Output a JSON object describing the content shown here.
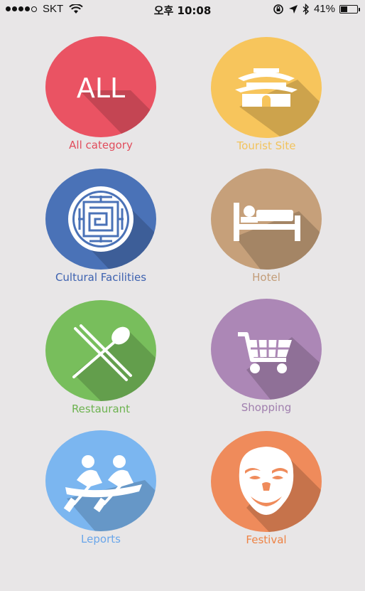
{
  "status_bar": {
    "carrier": "SKT",
    "time": "오후 10:08",
    "battery_percent": "41%",
    "battery_level": 0.41
  },
  "categories": [
    {
      "label": "All category",
      "icon": "all-icon",
      "color": "#ea5363",
      "label_color": "#e14d5c",
      "icon_text": "ALL"
    },
    {
      "label": "Tourist Site",
      "icon": "palace-gate-icon",
      "color": "#f7c55c",
      "label_color": "#f2c35c"
    },
    {
      "label": "Cultural Facilities",
      "icon": "maze-pattern-icon",
      "color": "#4a72b7",
      "label_color": "#3e62b0"
    },
    {
      "label": "Hotel",
      "icon": "bed-icon",
      "color": "#c6a07a",
      "label_color": "#c29c78"
    },
    {
      "label": "Restaurant",
      "icon": "fork-spoon-icon",
      "color": "#78be5c",
      "label_color": "#6db350"
    },
    {
      "label": "Shopping",
      "icon": "shopping-cart-icon",
      "color": "#ac87b6",
      "label_color": "#a07fae"
    },
    {
      "label": "Leports",
      "icon": "rowing-icon",
      "color": "#7bb6f0",
      "label_color": "#6aa6ea"
    },
    {
      "label": "Festival",
      "icon": "mask-icon",
      "color": "#ef8b5b",
      "label_color": "#ee8345"
    }
  ]
}
